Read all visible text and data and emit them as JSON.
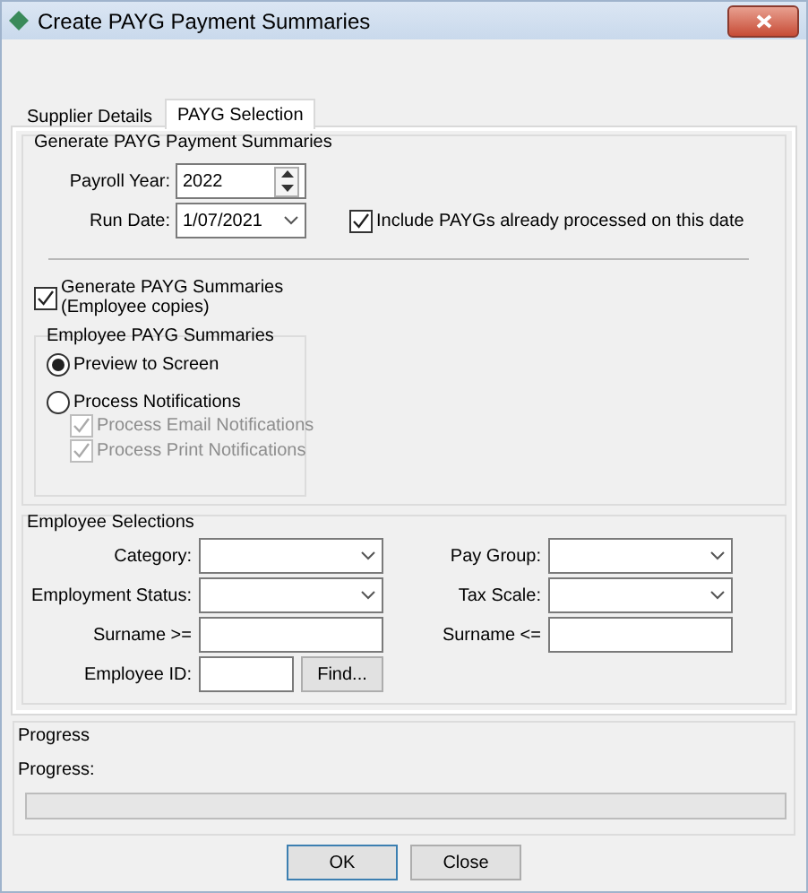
{
  "window": {
    "title": "Create PAYG Payment Summaries"
  },
  "tabs": [
    {
      "label": "Supplier Details",
      "selected": false
    },
    {
      "label": "PAYG Selection",
      "selected": true
    }
  ],
  "generate_group": {
    "title": "Generate PAYG Payment Summaries",
    "payroll_year": {
      "label": "Payroll Year:",
      "value": "2022"
    },
    "run_date": {
      "label": "Run Date:",
      "value": "1/07/2021"
    },
    "include_processed": {
      "label": "Include PAYGs already processed on this date",
      "checked": true
    }
  },
  "generate_summaries": {
    "label": "Generate PAYG Summaries (Employee copies)",
    "checked": true
  },
  "employee_summaries": {
    "title": "Employee PAYG Summaries",
    "options": [
      {
        "label": "Preview to Screen",
        "selected": true
      },
      {
        "label": "Process Notifications",
        "selected": false
      }
    ],
    "notifications": [
      {
        "label": "Process Email Notifications",
        "checked": true,
        "disabled": true
      },
      {
        "label": "Process Print Notifications",
        "checked": true,
        "disabled": true
      }
    ]
  },
  "employee_selections": {
    "title": "Employee Selections",
    "fields": [
      {
        "label": "Category:",
        "kind": "dropdown"
      },
      {
        "label": "Pay Group:",
        "kind": "dropdown"
      },
      {
        "label": "Employment Status:",
        "kind": "dropdown"
      },
      {
        "label": "Tax Scale:",
        "kind": "dropdown"
      },
      {
        "label": "Surname >=",
        "kind": "text"
      },
      {
        "label": "Surname <=",
        "kind": "text"
      },
      {
        "label": "Employee ID:",
        "kind": "short"
      }
    ],
    "find_button": "Find..."
  },
  "progress": {
    "title": "Progress",
    "label": "Progress:",
    "level": 0
  },
  "buttons": [
    {
      "label": "OK",
      "default": true
    },
    {
      "label": "Close",
      "default": false
    }
  ]
}
